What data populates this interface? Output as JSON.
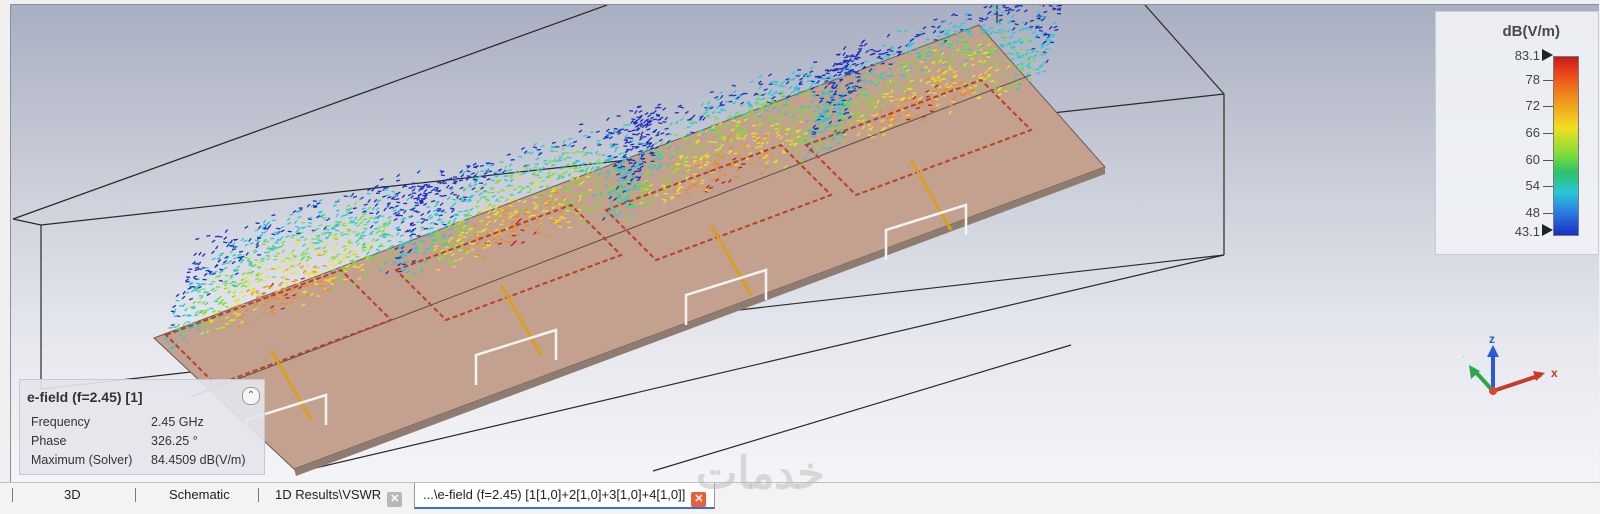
{
  "legend": {
    "title": "dB(V/m)",
    "max_label": "83.1",
    "min_label": "43.1",
    "ticks": [
      "78",
      "72",
      "66",
      "60",
      "54",
      "48"
    ],
    "gradient_colors": [
      "#c21a1a",
      "#f08a1c",
      "#f0e020",
      "#7cdc3a",
      "#28c8d8",
      "#1a2ec0"
    ]
  },
  "info": {
    "title": "e-field (f=2.45) [1]",
    "frequency_label": "Frequency",
    "frequency_value": "2.45 GHz",
    "phase_label": "Phase",
    "phase_value": "326.25 °",
    "maximum_label": "Maximum (Solver)",
    "maximum_value": "84.4509 dB(V/m)"
  },
  "axes": {
    "x": "x",
    "y": "y",
    "z": "z",
    "x_color": "#c83c2a",
    "y_color": "#2aa84a",
    "z_color": "#2a5ad8"
  },
  "tabs": {
    "t1": "3D",
    "t2": "Schematic",
    "t3": "1D Results\\VSWR",
    "t4": "...\\e-field (f=2.45) [1[1,0]+2[1,0]+3[1,0]+4[1,0]]"
  },
  "scene": {
    "substrate_color": "#c4a08e",
    "patch_count": 4
  },
  "watermark": "خدمات"
}
